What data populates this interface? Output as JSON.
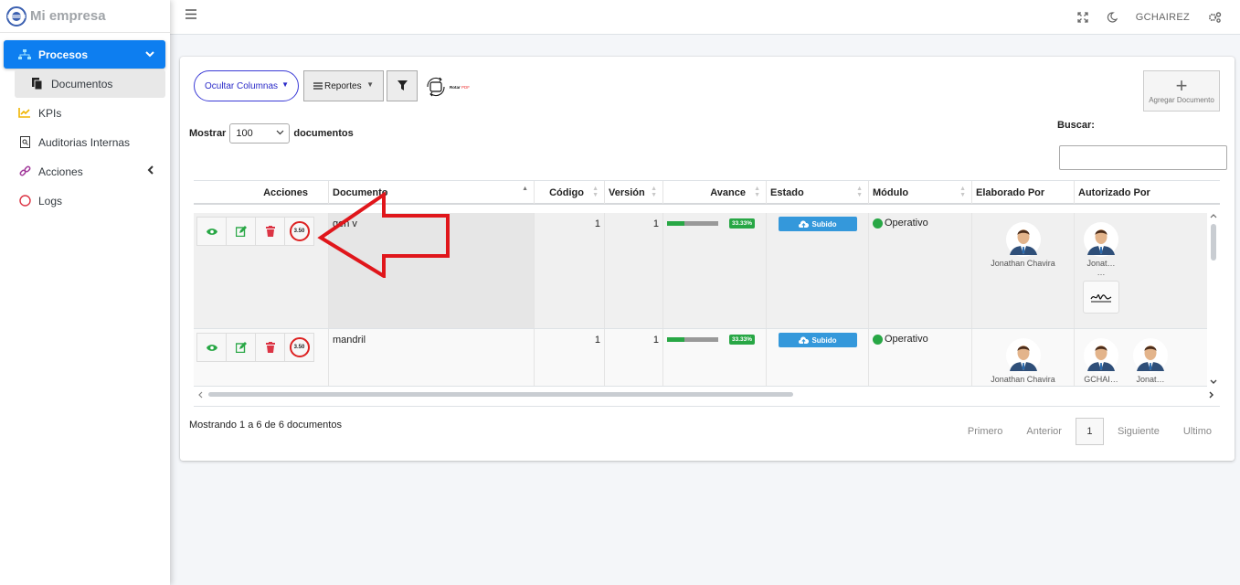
{
  "brand": {
    "name": "Mi empresa"
  },
  "sidebar": {
    "items": [
      {
        "label": "Procesos"
      },
      {
        "label": "Documentos"
      },
      {
        "label": "KPIs"
      },
      {
        "label": "Auditorias Internas"
      },
      {
        "label": "Acciones"
      },
      {
        "label": "Logs"
      }
    ]
  },
  "topbar": {
    "user": "GCHAIREZ"
  },
  "toolbar": {
    "ocultar_label": "Ocultar Columnas",
    "reportes_label": "Reportes",
    "rotar_label": "Rotar",
    "rotar_pdf": "PDF",
    "add_label": "Agregar Documento"
  },
  "length_control": {
    "prefix": "Mostrar",
    "value": "100",
    "suffix": "documentos"
  },
  "search": {
    "label": "Buscar:",
    "value": ""
  },
  "table": {
    "headers": [
      "Acciones",
      "Documento",
      "Código",
      "Versión",
      "Avance",
      "Estado",
      "Módulo",
      "Elaborado Por",
      "Autorizado Por"
    ],
    "rows": [
      {
        "badge": "3.50",
        "documento": "gen v",
        "codigo": "1",
        "version": "1",
        "avance": 33.33,
        "avance_label": "33.33%",
        "estado": "Subido",
        "modulo": "Operativo",
        "elaborado": "Jonathan Chavira",
        "autorizado": [
          "Jonat…"
        ]
      },
      {
        "badge": "3.50",
        "documento": "mandril",
        "codigo": "1",
        "version": "1",
        "avance": 33.33,
        "avance_label": "33.33%",
        "estado": "Subido",
        "modulo": "Operativo",
        "elaborado": "Jonathan Chavira",
        "autorizado": [
          "GCHAI…",
          "Jonat…"
        ]
      }
    ]
  },
  "footer": {
    "info": "Mostrando 1 a 6 de 6 documentos",
    "pagination": {
      "first": "Primero",
      "prev": "Anterior",
      "current": "1",
      "next": "Siguiente",
      "last": "Ultimo"
    }
  },
  "colors": {
    "primary": "#0d7ef0",
    "success": "#28a745",
    "info": "#3498db",
    "danger": "#d22",
    "ocultar_border": "#3b3bd6"
  }
}
